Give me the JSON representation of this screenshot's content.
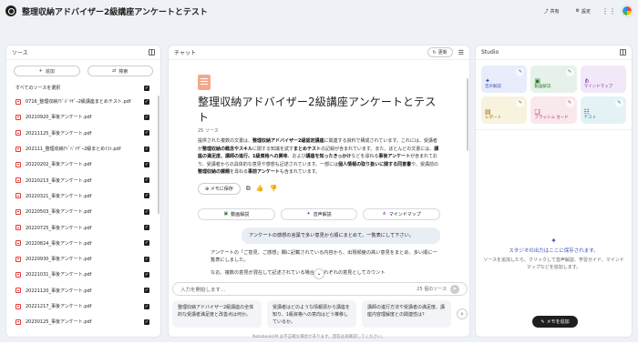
{
  "header": {
    "title": "整理収納アドバイザー2級講座アンケートとテスト",
    "share_label": "共有",
    "settings_label": "設定"
  },
  "sources": {
    "title": "ソース",
    "add_label": "追加",
    "discover_label": "検索",
    "select_all_label": "すべてのソースを選択",
    "items": [
      "0716_整理収納ｱﾄﾞﾊﾞｲｻﾞｰ2級講座まとめテスト.pdf",
      "20210920_事後アンケート.pdf",
      "20211125_事後アンケート.pdf",
      "202111_整理収納ｱﾄﾞﾊﾞｲｻﾞｰ2級まとめﾃｽﾄ.pdf",
      "20220202_事後アンケート.pdf",
      "20220213_事後アンケート.pdf",
      "20220321_事後アンケート.pdf",
      "20220503_事後アンケート.pdf",
      "20220725_事後アンケート.pdf",
      "20220824_事後アンケート.pdf",
      "20220930_事後アンケート.pdf",
      "20221031_事後アンケート.pdf",
      "20221120_事後アンケート.pdf",
      "20221217_事後アンケート.pdf",
      "20230125_事後アンケート.pdf"
    ]
  },
  "chat": {
    "title": "チャット",
    "refresh_label": "更新",
    "notebook_title": "整理収納アドバイザー2級講座アンケートとテスト",
    "source_count": "25 ソース",
    "summary_1": "提供された複数の文書は、",
    "summary_b1": "整理収納アドバイザー2級認定講座",
    "summary_2": "に関連する資料で構成されています。これには、受講者が",
    "summary_b2": "整理収納の概念やスキル",
    "summary_3": "に関する知識を試す",
    "summary_b3": "まとめテスト",
    "summary_4": "の記録が含まれています。また、ほとんどの文書には、",
    "summary_b4": "講座の満足度、講師の進行、1級資格への興味",
    "summary_5": "、および",
    "summary_b5": "講座を知ったきっかけ",
    "summary_6": "などを尋ねる",
    "summary_b6": "事後アンケート",
    "summary_7": "が含まれており、受講者からの具体的な意見や感想も記述されています。一部には",
    "summary_b7": "個人情報の取り扱いに関する同意書",
    "summary_8": "や、受講前の",
    "summary_b8": "整理収納の課題",
    "summary_9": "を尋ねる",
    "summary_b9": "事前アンケート",
    "summary_10": "も含まれています。",
    "save_note_label": "メモに保存",
    "audio_buttons": [
      "動画解説",
      "音声解説",
      "マインドマップ"
    ],
    "user_message": "アンケートの感想の言葉で多い意見から順にまとめて、一覧表にして下さい。",
    "answer_1": "アンケートの「ご意見、ご感想」欄に記載されている内容から、出現頻度の高い意見をまとめ、多い順に一覧表にしました。",
    "answer_2": "なお、複数の意見が混在して記述されている場合、それぞれの意見としてカウント",
    "input_placeholder": "入力を開始します...",
    "input_source_count": "25 個のソース",
    "suggestions": [
      "整理収納アドバイザー2級講座の全体的な受講者満足度と改善点は何か。",
      "受講者はどのような情報源から講座を知り、1級資格への意向はどう推移しているか。",
      "講師の進行方法や受講者の満足度、講座内容理解度との関連性は？"
    ]
  },
  "studio": {
    "title": "Studio",
    "tiles": [
      {
        "label": "音声解説",
        "icon": "audio-icon"
      },
      {
        "label": "動画解説",
        "icon": "video-icon"
      },
      {
        "label": "マインドマップ",
        "icon": "mindmap-icon"
      },
      {
        "label": "レポート",
        "icon": "report-icon"
      },
      {
        "label": "フラッシュ カード",
        "icon": "flashcard-icon"
      },
      {
        "label": "テスト",
        "icon": "quiz-icon"
      }
    ],
    "empty_title": "スタジオの出力はここに保存されます。",
    "empty_desc": "ソースを追加したら、クリックして音声解説、学習ガイド、マインドマップなどを追加します。",
    "add_note_label": "メモを追加"
  },
  "footer": {
    "text": "NotebookLM は不正確な場合があります。回答は再確認してください。"
  }
}
